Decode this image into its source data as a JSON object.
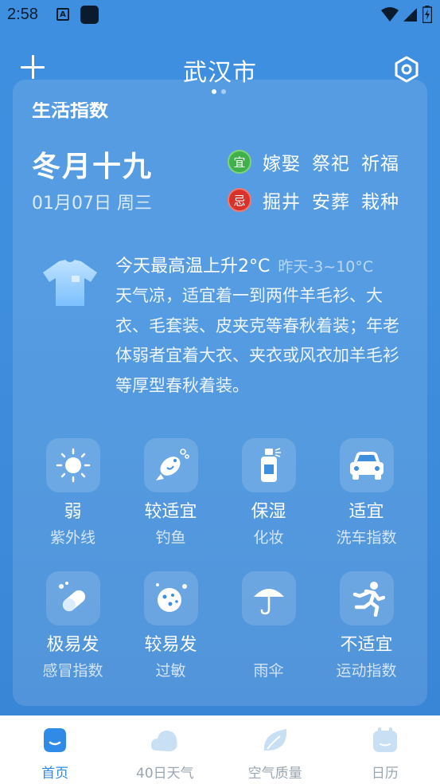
{
  "status_bar": {
    "time": "2:58",
    "a_icon_letter": "A"
  },
  "header": {
    "city": "武汉市"
  },
  "life_index": {
    "section_title": "生活指数",
    "lunar_date": "冬月十九",
    "solar_date": "01月07日 周三",
    "good": {
      "badge": "宜",
      "items": [
        "嫁娶",
        "祭祀",
        "祈福"
      ]
    },
    "bad": {
      "badge": "忌",
      "items": [
        "掘井",
        "安葬",
        "栽种"
      ]
    },
    "temperature": {
      "headline": "今天最高温上升2°C",
      "yesterday": "昨天-3~10°C",
      "advice": "天气凉，适宜着一到两件羊毛衫、大衣、毛套装、皮夹克等春秋着装；年老体弱者宜着大衣、夹衣或风衣加羊毛衫等厚型春秋着装。"
    },
    "indices": [
      {
        "icon": "sun-icon",
        "level": "弱",
        "name": "紫外线"
      },
      {
        "icon": "fish-icon",
        "level": "较适宜",
        "name": "钓鱼"
      },
      {
        "icon": "spray-bottle-icon",
        "level": "保湿",
        "name": "化妆"
      },
      {
        "icon": "car-icon",
        "level": "适宜",
        "name": "洗车指数"
      },
      {
        "icon": "pill-icon",
        "level": "极易发",
        "name": "感冒指数"
      },
      {
        "icon": "allergy-icon",
        "level": "较易发",
        "name": "过敏"
      },
      {
        "icon": "umbrella-icon",
        "level": "",
        "name": "雨伞"
      },
      {
        "icon": "running-icon",
        "level": "不适宜",
        "name": "运动指数"
      }
    ]
  },
  "bottom_nav": [
    {
      "icon": "home-icon",
      "label": "首页",
      "active": true
    },
    {
      "icon": "cloud-icon",
      "label": "40日天气",
      "active": false
    },
    {
      "icon": "leaf-icon",
      "label": "空气质量",
      "active": false
    },
    {
      "icon": "calendar-icon",
      "label": "日历",
      "active": false
    }
  ],
  "colors": {
    "accent": "#2f8be6",
    "background": "#3f8fe0",
    "good_badge": "#3fb04a",
    "bad_badge": "#d8322b"
  }
}
